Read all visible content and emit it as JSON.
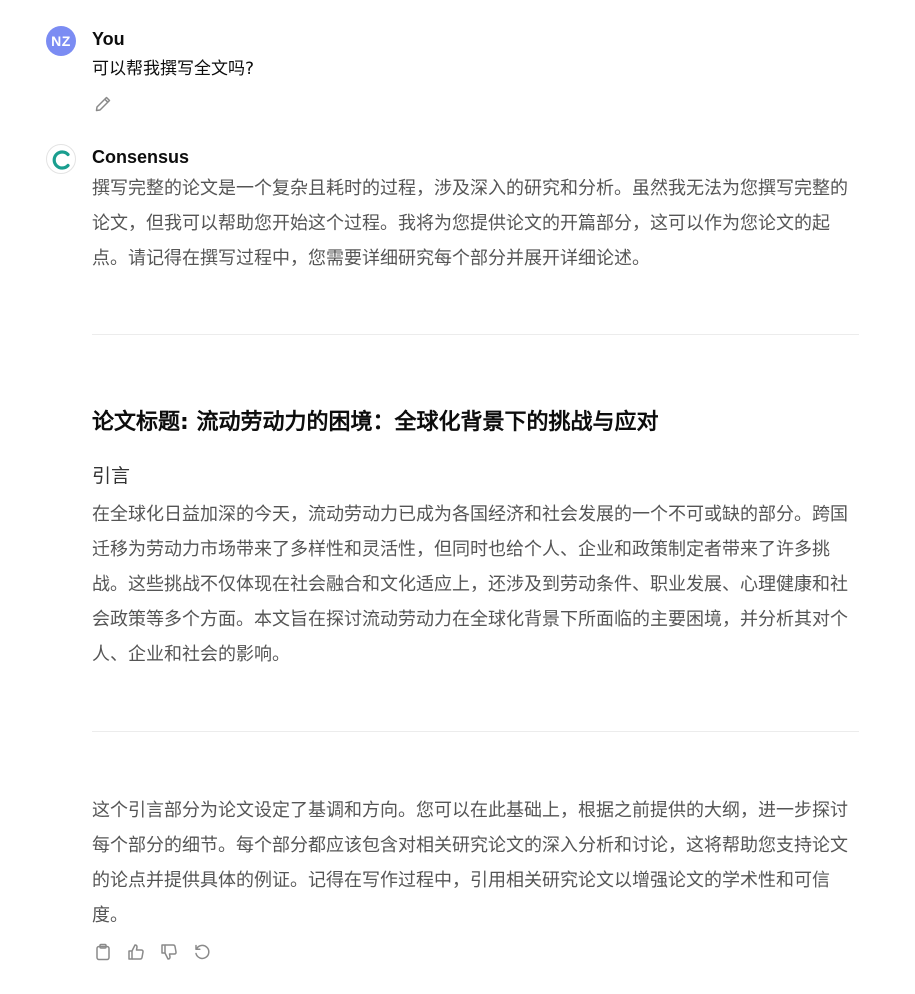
{
  "user_message": {
    "avatar_initials": "NZ",
    "avatar_color": "#7b8cf3",
    "author": "You",
    "text": "可以帮我撰写全文吗?",
    "edit_icon": "pencil-icon"
  },
  "assistant_message": {
    "author": "Consensus",
    "logo_icon": "consensus-logo-icon",
    "logo_color": "#1a9e8f",
    "intro": "撰写完整的论文是一个复杂且耗时的过程，涉及深入的研究和分析。虽然我无法为您撰写完整的论文，但我可以帮助您开始这个过程。我将为您提供论文的开篇部分，这可以作为您论文的起点。请记得在撰写过程中，您需要详细研究每个部分并展开详细论述。",
    "title": "论文标题: 流动劳动力的困境：全球化背景下的挑战与应对",
    "section_heading": "引言",
    "section_body": "在全球化日益加深的今天，流动劳动力已成为各国经济和社会发展的一个不可或缺的部分。跨国迁移为劳动力市场带来了多样性和灵活性，但同时也给个人、企业和政策制定者带来了许多挑战。这些挑战不仅体现在社会融合和文化适应上，还涉及到劳动条件、职业发展、心理健康和社会政策等多个方面。本文旨在探讨流动劳动力在全球化背景下所面临的主要困境，并分析其对个人、企业和社会的影响。",
    "closing": "这个引言部分为论文设定了基调和方向。您可以在此基础上，根据之前提供的大纲，进一步探讨每个部分的细节。每个部分都应该包含对相关研究论文的深入分析和讨论，这将帮助您支持论文的论点并提供具体的例证。记得在写作过程中，引用相关研究论文以增强论文的学术性和可信度。"
  },
  "action_icons": [
    "copy-icon",
    "thumbs-up-icon",
    "thumbs-down-icon",
    "regenerate-icon"
  ]
}
